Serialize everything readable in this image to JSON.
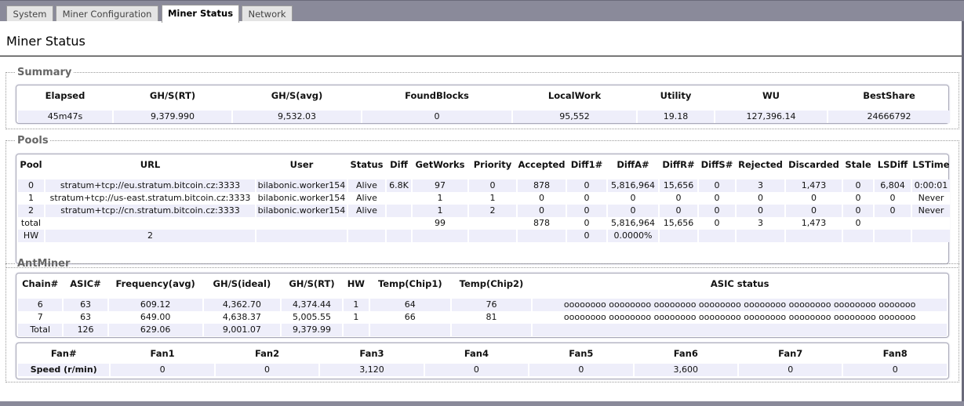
{
  "tabs": [
    {
      "label": "System"
    },
    {
      "label": "Miner Configuration"
    },
    {
      "label": "Miner Status"
    },
    {
      "label": "Network"
    }
  ],
  "page_title": "Miner Status",
  "summary": {
    "legend": "Summary",
    "headers": [
      "Elapsed",
      "GH/S(RT)",
      "GH/S(avg)",
      "FoundBlocks",
      "LocalWork",
      "Utility",
      "WU",
      "BestShare"
    ],
    "row": [
      "45m47s",
      "9,379.990",
      "9,532.03",
      "0",
      "95,552",
      "19.18",
      "127,396.14",
      "24666792"
    ]
  },
  "pools": {
    "legend": "Pools",
    "headers": [
      "Pool",
      "URL",
      "User",
      "Status",
      "Diff",
      "GetWorks",
      "Priority",
      "Accepted",
      "Diff1#",
      "DiffA#",
      "DiffR#",
      "DiffS#",
      "Rejected",
      "Discarded",
      "Stale",
      "LSDiff",
      "LSTime"
    ],
    "rows": [
      [
        "0",
        "stratum+tcp://eu.stratum.bitcoin.cz:3333",
        "bilabonic.worker154",
        "Alive",
        "6.8K",
        "97",
        "0",
        "878",
        "0",
        "5,816,964",
        "15,656",
        "0",
        "3",
        "1,473",
        "0",
        "6,804",
        "0:00:01"
      ],
      [
        "1",
        "stratum+tcp://us-east.stratum.bitcoin.cz:3333",
        "bilabonic.worker154",
        "Alive",
        "",
        "1",
        "1",
        "0",
        "0",
        "0",
        "0",
        "0",
        "0",
        "0",
        "0",
        "0",
        "Never"
      ],
      [
        "2",
        "stratum+tcp://cn.stratum.bitcoin.cz:3333",
        "bilabonic.worker154",
        "Alive",
        "",
        "1",
        "2",
        "0",
        "0",
        "0",
        "0",
        "0",
        "0",
        "0",
        "0",
        "0",
        "Never"
      ],
      [
        "total",
        "",
        "",
        "",
        "",
        "99",
        "",
        "878",
        "0",
        "5,816,964",
        "15,656",
        "0",
        "3",
        "1,473",
        "0",
        "",
        ""
      ],
      [
        "HW",
        "2",
        "",
        "",
        "",
        "",
        "",
        "",
        "0",
        "0.0000%",
        "",
        "",
        "",
        "",
        "",
        "",
        ""
      ]
    ]
  },
  "antminer": {
    "legend": "AntMiner",
    "headers": [
      "Chain#",
      "ASIC#",
      "Frequency(avg)",
      "GH/S(ideal)",
      "GH/S(RT)",
      "HW",
      "Temp(Chip1)",
      "Temp(Chip2)",
      "ASIC status"
    ],
    "rows": [
      [
        "6",
        "63",
        "609.12",
        "4,362.70",
        "4,374.44",
        "1",
        "64",
        "76",
        "oooooooo oooooooo oooooooo oooooooo oooooooo oooooooo oooooooo ooooooo"
      ],
      [
        "7",
        "63",
        "649.00",
        "4,638.37",
        "5,005.55",
        "1",
        "66",
        "81",
        "oooooooo oooooooo oooooooo oooooooo oooooooo oooooooo oooooooo ooooooo"
      ],
      [
        "Total",
        "126",
        "629.06",
        "9,001.07",
        "9,379.99",
        "",
        "",
        "",
        ""
      ]
    ],
    "fans": {
      "headers": [
        "Fan#",
        "Fan1",
        "Fan2",
        "Fan3",
        "Fan4",
        "Fan5",
        "Fan6",
        "Fan7",
        "Fan8"
      ],
      "row": [
        "Speed (r/min)",
        "0",
        "0",
        "3,120",
        "0",
        "0",
        "3,600",
        "0",
        "0"
      ]
    }
  }
}
